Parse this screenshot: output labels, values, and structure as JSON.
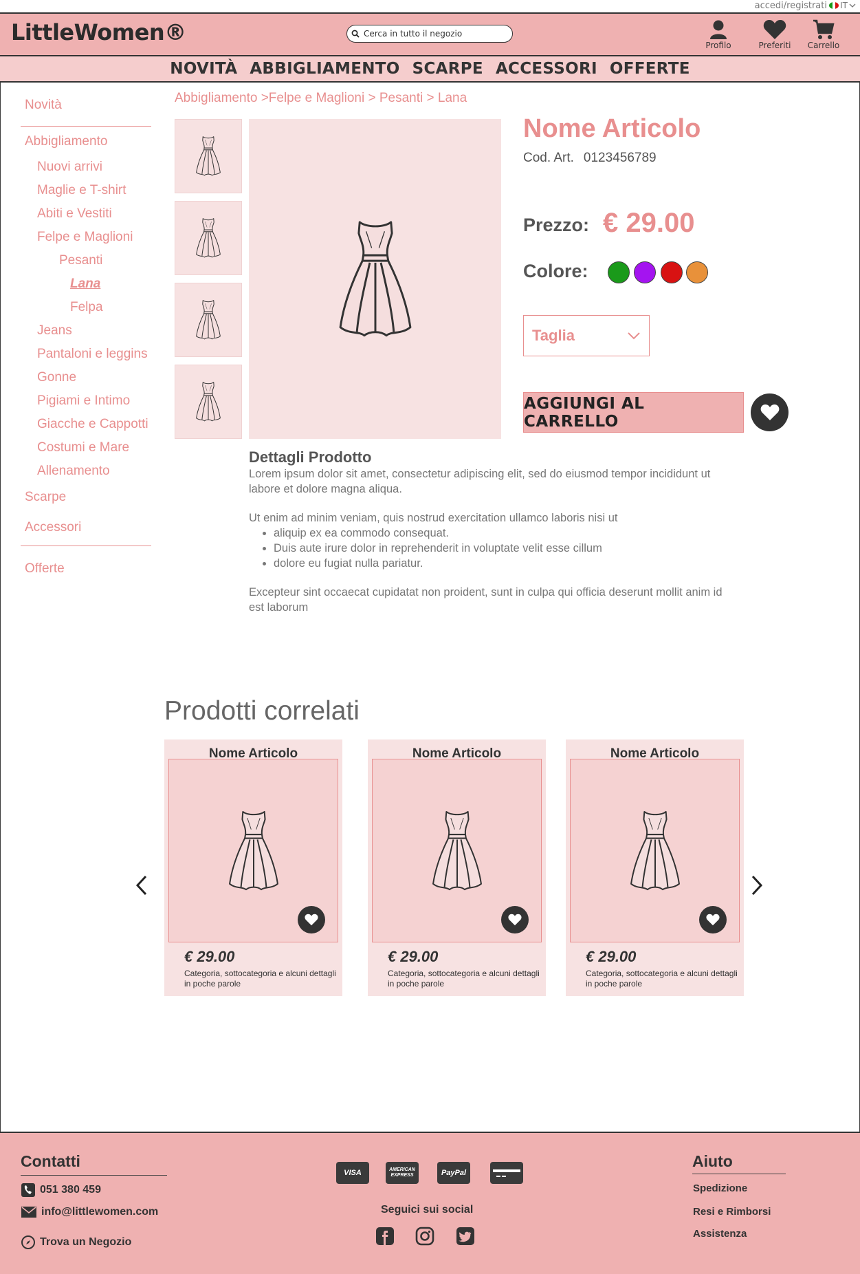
{
  "topbar": {
    "login": "accedi/registrati",
    "lang": "IT"
  },
  "header": {
    "logo": "LittleWomen®",
    "search_placeholder": "Cerca in tutto il negozio",
    "profile": "Profilo",
    "favorites": "Preferiti",
    "cart": "Carrello"
  },
  "nav": [
    "NOVITÀ",
    "ABBIGLIAMENTO",
    "SCARPE",
    "ACCESSORI",
    "OFFERTE"
  ],
  "sidebar": {
    "novita": "Novità",
    "abbigliamento": "Abbigliamento",
    "sub": [
      "Nuovi arrivi",
      "Maglie e T-shirt",
      "Abiti e Vestiti",
      "Felpe e Maglioni"
    ],
    "pesanti": "Pesanti",
    "lana": "Lana",
    "felpa": "Felpa",
    "sub2": [
      "Jeans",
      "Pantaloni e leggins",
      "Gonne",
      "Pigiami e Intimo",
      "Giacche e Cappotti",
      "Costumi e Mare",
      "Allenamento"
    ],
    "scarpe": "Scarpe",
    "accessori": "Accessori",
    "offerte": "Offerte"
  },
  "breadcrumb": "Abbigliamento >Felpe e Maglioni > Pesanti > Lana",
  "product": {
    "name": "Nome Articolo",
    "code_label": "Cod. Art.",
    "code": "0123456789",
    "price_label": "Prezzo:",
    "price": "€ 29.00",
    "color_label": "Colore:",
    "colors": [
      "#1a9a1a",
      "#a414f0",
      "#d81212",
      "#e8913a"
    ],
    "size_label": "Taglia",
    "add_to_cart": "AGGIUNGI AL CARRELLO"
  },
  "details": {
    "title": "Dettagli Prodotto",
    "p1": "Lorem ipsum dolor sit amet, consectetur adipiscing elit, sed do eiusmod tempor incididunt ut labore et dolore magna aliqua.",
    "p2": "Ut enim ad minim veniam, quis nostrud exercitation ullamco laboris nisi ut",
    "bullets": [
      "aliquip ex ea commodo consequat.",
      "Duis aute irure dolor in reprehenderit in voluptate velit esse cillum",
      "dolore eu fugiat nulla pariatur."
    ],
    "p3": "Excepteur sint occaecat cupidatat non proident, sunt in culpa qui officia deserunt mollit anim id est laborum"
  },
  "related": {
    "title": "Prodotti correlati",
    "items": [
      {
        "name": "Nome Articolo",
        "price": "€ 29.00",
        "desc": "Categoria, sottocategoria e alcuni dettagli in poche parole"
      },
      {
        "name": "Nome Articolo",
        "price": "€ 29.00",
        "desc": "Categoria, sottocategoria e alcuni dettagli in poche parole"
      },
      {
        "name": "Nome Articolo",
        "price": "€ 29.00",
        "desc": "Categoria, sottocategoria e alcuni dettagli in poche parole"
      }
    ]
  },
  "footer": {
    "contacts_title": "Contatti",
    "phone": "051 380 459",
    "email": "info@littlewomen.com",
    "store": "Trova un Negozio",
    "payments": [
      "VISA",
      "AMERICAN EXPRESS",
      "PayPal",
      "card"
    ],
    "social_title": "Seguici sui social",
    "social": [
      "facebook-icon",
      "instagram-icon",
      "twitter-icon"
    ],
    "help_title": "Aiuto",
    "help": [
      "Spedizione",
      "Resi e Rimborsi",
      "Assistenza"
    ]
  }
}
